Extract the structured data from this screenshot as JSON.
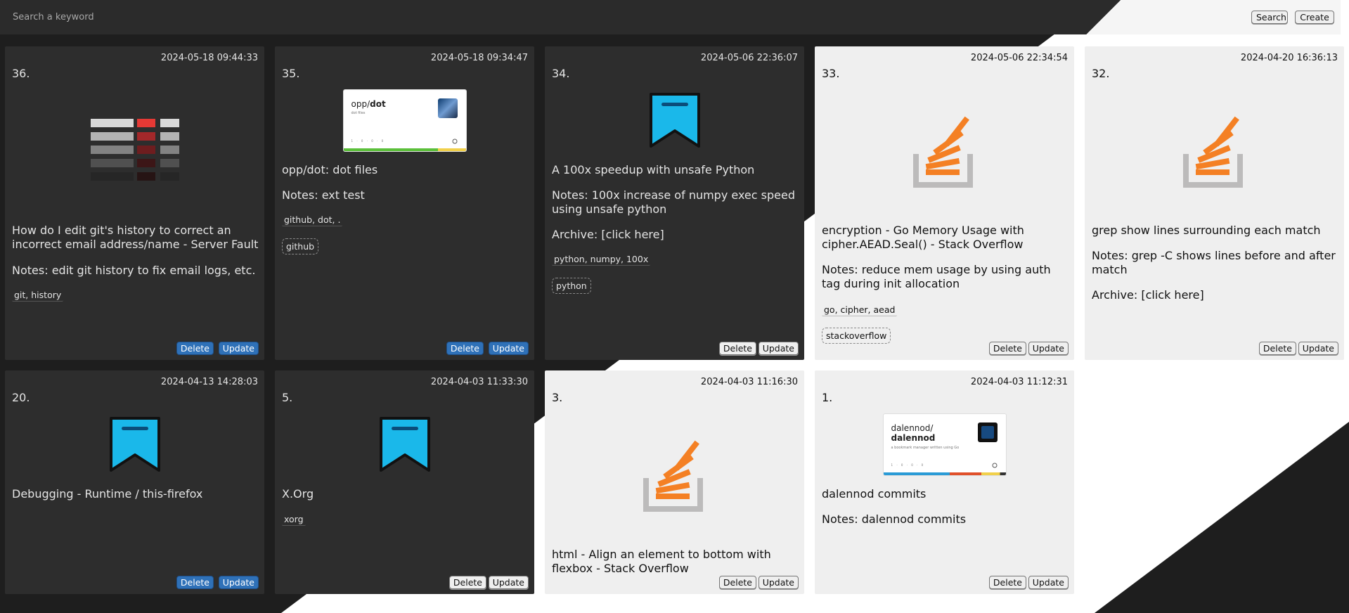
{
  "search": {
    "placeholder": "Search a keyword",
    "value": "",
    "button": "Search"
  },
  "create_button": "Create",
  "cards": [
    {
      "num": "36.",
      "date": "2024-05-18 09:44:33",
      "thumb": "table-grid-icon",
      "title": "How do I edit git's history to correct an incorrect email address/name - Server Fault",
      "notes": "Notes: edit git history to fix email logs, etc.",
      "tags": "git, history",
      "delete": "Delete",
      "update": "Update"
    },
    {
      "num": "35.",
      "date": "2024-05-18 09:34:47",
      "thumb": "github-repo-card",
      "repo": {
        "owner": "opp/",
        "name": "dot",
        "desc": "dot files",
        "stats": "1 · 0 · 0 · 0"
      },
      "title": "opp/dot: dot files",
      "notes": "Notes: ext test",
      "tags": "github, dot, .",
      "chip": "github",
      "delete": "Delete",
      "update": "Update"
    },
    {
      "num": "34.",
      "date": "2024-05-06 22:36:07",
      "thumb": "bookmark-icon",
      "title": "A 100x speedup with unsafe Python",
      "notes": "Notes: 100x increase of numpy exec speed using unsafe python",
      "archive": "Archive: [click here]",
      "tags": "python, numpy, 100x",
      "chip": "python",
      "delete": "Delete",
      "update": "Update"
    },
    {
      "num": "33.",
      "date": "2024-05-06 22:34:54",
      "thumb": "stackoverflow-icon",
      "title": "encryption - Go Memory Usage with cipher.AEAD.Seal() - Stack Overflow",
      "notes": "Notes: reduce mem usage by using auth tag during init allocation",
      "tags": "go, cipher, aead",
      "chip": "stackoverflow",
      "delete": "Delete",
      "update": "Update"
    },
    {
      "num": "32.",
      "date": "2024-04-20 16:36:13",
      "thumb": "stackoverflow-icon",
      "title": "grep show lines surrounding each match",
      "notes": "Notes: grep -C shows lines before and after match",
      "archive": "Archive: [click here]",
      "delete": "Delete",
      "update": "Update"
    },
    {
      "num": "20.",
      "date": "2024-04-13 14:28:03",
      "thumb": "bookmark-icon",
      "title": "Debugging - Runtime / this-firefox",
      "delete": "Delete",
      "update": "Update"
    },
    {
      "num": "5.",
      "date": "2024-04-03 11:33:30",
      "thumb": "bookmark-icon",
      "title": "X.Org",
      "tags": "xorg",
      "delete": "Delete",
      "update": "Update"
    },
    {
      "num": "3.",
      "date": "2024-04-03 11:16:30",
      "thumb": "stackoverflow-icon",
      "title": "html - Align an element to bottom with flexbox - Stack Overflow",
      "delete": "Delete",
      "update": "Update"
    },
    {
      "num": "1.",
      "date": "2024-04-03 11:12:31",
      "thumb": "github-repo-card",
      "repo": {
        "owner": "dalennod/",
        "name": "dalennod",
        "desc": "a bookmark manager written using Go",
        "stats": "1 · 0 · 0 · 0"
      },
      "title": "dalennod commits",
      "notes": "Notes: dalennod commits",
      "delete": "Delete",
      "update": "Update"
    }
  ],
  "colors": {
    "dark_card": "#2d2d2d",
    "light_card": "#efefef",
    "page_dark": "#1e1e1e",
    "button_blue": "#2f71b8",
    "stackoverflow_orange": "#f48024",
    "bookmark_blue": "#1ab8ea"
  }
}
